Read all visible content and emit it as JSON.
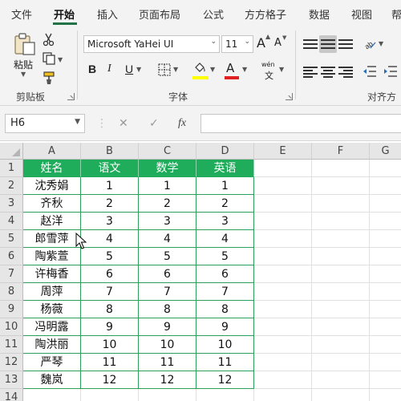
{
  "menu": {
    "tabs": [
      "文件",
      "开始",
      "插入",
      "页面布局",
      "公式",
      "方方格子",
      "数据",
      "视图",
      "帮"
    ],
    "active_index": 1
  },
  "ribbon": {
    "clipboard": {
      "paste_label": "粘贴",
      "group_label": "剪贴板"
    },
    "font": {
      "font_name": "Microsoft YaHei UI",
      "font_size": "11",
      "grow_label": "A",
      "shrink_label": "A",
      "bold": "B",
      "italic": "I",
      "underline": "U",
      "font_color_label": "A",
      "phonetic_top": "wén",
      "phonetic_bottom": "文",
      "group_label": "字体",
      "fill_color": "#ffff00",
      "font_color": "#e02020"
    },
    "alignment": {
      "group_label": "对齐方"
    }
  },
  "formula_bar": {
    "name_box": "H6",
    "cancel_symbol": "✕",
    "enter_symbol": "✓",
    "fx_symbol": "fx",
    "formula": ""
  },
  "sheet": {
    "columns": [
      "A",
      "B",
      "C",
      "D",
      "E",
      "F",
      "G"
    ],
    "row_numbers": [
      "1",
      "2",
      "3",
      "4",
      "5",
      "6",
      "7",
      "8",
      "9",
      "10",
      "11",
      "12",
      "13",
      "14"
    ],
    "rows": [
      [
        "姓名",
        "语文",
        "数学",
        "英语"
      ],
      [
        "沈秀娟",
        "1",
        "1",
        "1"
      ],
      [
        "齐秋",
        "2",
        "2",
        "2"
      ],
      [
        "赵洋",
        "3",
        "3",
        "3"
      ],
      [
        "郎雪萍",
        "4",
        "4",
        "4"
      ],
      [
        "陶紫萱",
        "5",
        "5",
        "5"
      ],
      [
        "许梅香",
        "6",
        "6",
        "6"
      ],
      [
        "周萍",
        "7",
        "7",
        "7"
      ],
      [
        "杨薇",
        "8",
        "8",
        "8"
      ],
      [
        "冯明露",
        "9",
        "9",
        "9"
      ],
      [
        "陶洪丽",
        "10",
        "10",
        "10"
      ],
      [
        "严琴",
        "11",
        "11",
        "11"
      ],
      [
        "魏岚",
        "12",
        "12",
        "12"
      ]
    ],
    "header_color": "#1fad5b",
    "border_color": "#2e9e5b"
  }
}
